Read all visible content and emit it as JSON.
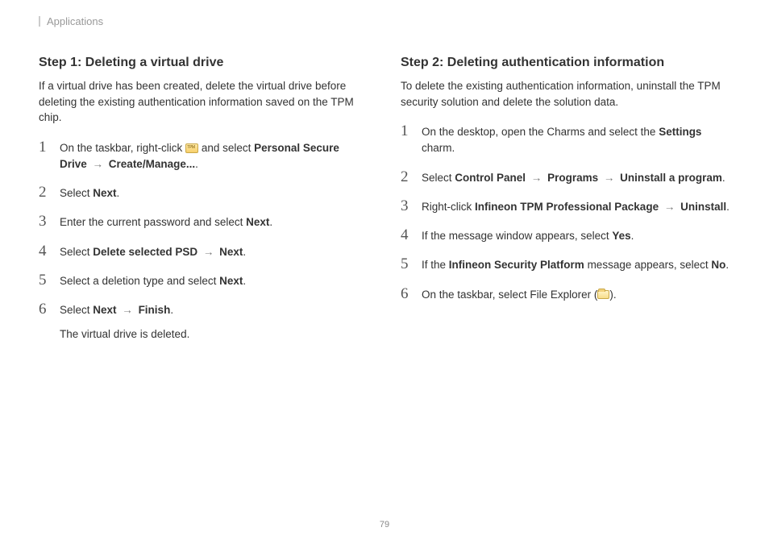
{
  "header": "Applications",
  "page_number": "79",
  "left": {
    "title": "Step 1: Deleting a virtual drive",
    "intro": "If a virtual drive has been created, delete the virtual drive before deleting the existing authentication information saved on the TPM chip.",
    "steps": [
      {
        "pre": "On the taskbar, right-click ",
        "icon": "tpm-icon",
        "mid": " and select ",
        "b1": "Personal Secure Drive",
        "arr": " → ",
        "b2": "Create/Manage...",
        "post": "."
      },
      {
        "pre": "Select ",
        "b1": "Next",
        "post": "."
      },
      {
        "pre": "Enter the current password and select ",
        "b1": "Next",
        "post": "."
      },
      {
        "pre": "Select ",
        "b1": "Delete selected PSD",
        "arr": " → ",
        "b2": "Next",
        "post": "."
      },
      {
        "pre": "Select a deletion type and select ",
        "b1": "Next",
        "post": "."
      },
      {
        "pre": "Select ",
        "b1": "Next",
        "arr": " → ",
        "b2": "Finish",
        "post": ".",
        "sub": "The virtual drive is deleted."
      }
    ]
  },
  "right": {
    "title": "Step 2: Deleting authentication information",
    "intro": "To delete the existing authentication information, uninstall the TPM security solution and delete the solution data.",
    "steps": [
      {
        "pre": "On the desktop, open the Charms and select the ",
        "b1": "Settings",
        "post": " charm."
      },
      {
        "pre": "Select ",
        "b1": "Control Panel",
        "arr": " → ",
        "b2": "Programs",
        "arr2": " → ",
        "b3": "Uninstall a program",
        "post": "."
      },
      {
        "pre": "Right-click ",
        "b1": "Infineon TPM Professional Package",
        "arr": " → ",
        "b2": "Uninstall",
        "post": "."
      },
      {
        "pre": "If the message window appears, select ",
        "b1": "Yes",
        "post": "."
      },
      {
        "pre": "If the ",
        "b1": "Infineon Security Platform",
        "mid": " message appears, select ",
        "b2": "No",
        "post": "."
      },
      {
        "pre": "On the taskbar, select File Explorer (",
        "icon": "file-explorer-icon",
        "post": ")."
      }
    ]
  }
}
